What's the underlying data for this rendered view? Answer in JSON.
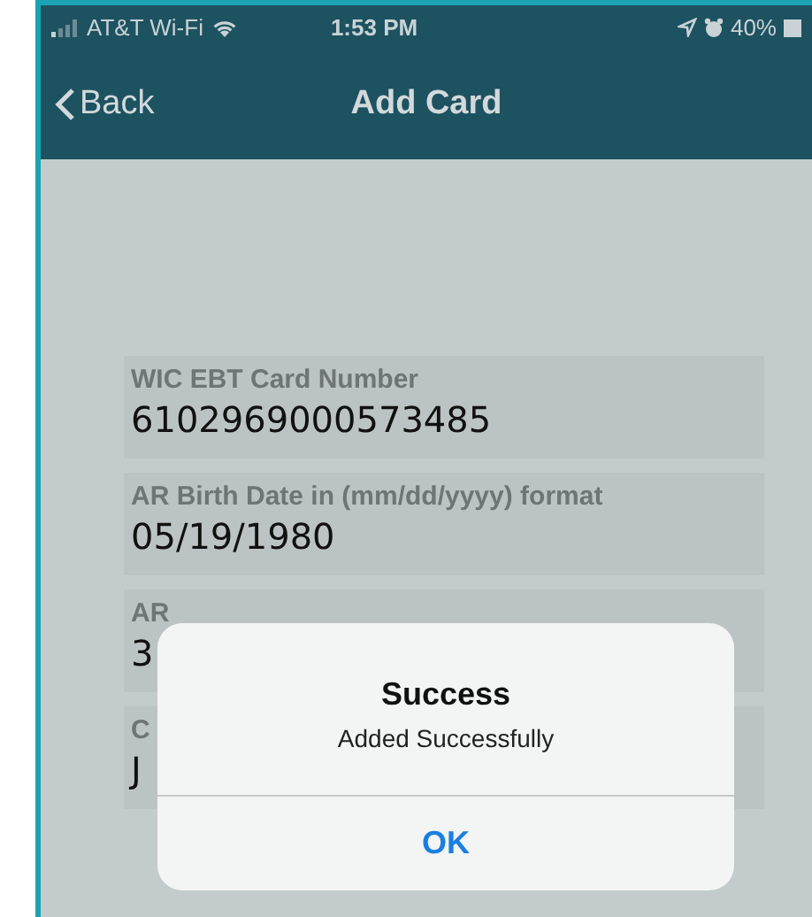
{
  "status_bar": {
    "carrier": "AT&T Wi-Fi",
    "time": "1:53 PM",
    "battery": "40%"
  },
  "nav_bar": {
    "back": "Back",
    "title": "Add Card"
  },
  "fields": [
    {
      "label": "WIC EBT Card Number",
      "value": "6102969000573485"
    },
    {
      "label": "AR Birth Date in (mm/dd/yyyy) format",
      "value": "05/19/1980"
    },
    {
      "label": "AR",
      "value": "3"
    },
    {
      "label": "C",
      "value": "J"
    }
  ],
  "alert": {
    "title": "Success",
    "message": "Added Successfully",
    "button": "OK"
  }
}
